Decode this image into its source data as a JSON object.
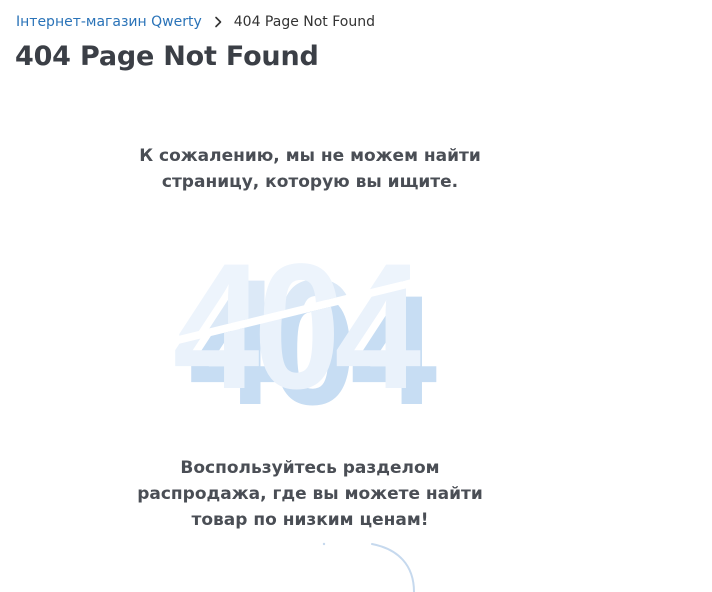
{
  "breadcrumb": {
    "home_label": "Інтернет-магазин Qwerty",
    "current_label": "404 Page Not Found"
  },
  "page": {
    "title": "404 Page Not Found"
  },
  "messages": {
    "sorry_lines": [
      "К сожалению, мы не можем найти",
      "страницу, которую вы ищите."
    ],
    "sale_lines": [
      "Воспользуйтесь разделом",
      "распродажа, где вы можете найти",
      "товар по низким ценам!"
    ]
  },
  "illustration": {
    "code": "404",
    "icon": "error-404-icon",
    "front_color": "#eaf2fb",
    "shadow_color": "#c7ddf3"
  },
  "colors": {
    "link": "#2a73b8",
    "title": "#3b3f46",
    "text": "#4a4e55",
    "decor": "#c6d9ee"
  }
}
